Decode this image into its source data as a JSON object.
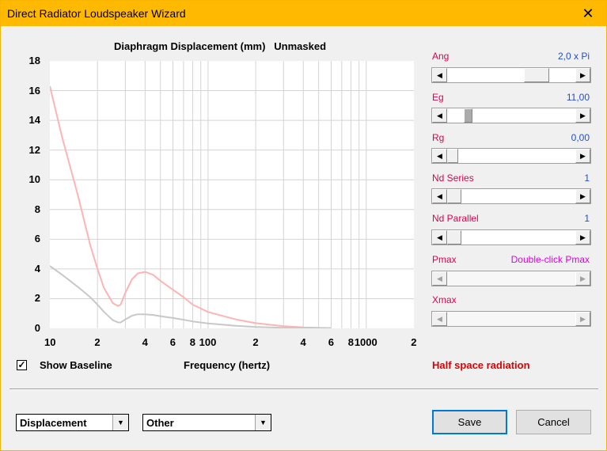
{
  "window": {
    "title": "Direct Radiator Loudspeaker Wizard",
    "close_glyph": "✕"
  },
  "chart_header": {
    "title": "Diaphragm Displacement (mm)",
    "mode": "Unmasked"
  },
  "chart_data": {
    "type": "line",
    "title": "Diaphragm Displacement (mm)   Unmasked",
    "xlabel": "Frequency (hertz)",
    "ylabel": "",
    "x_scale": "log",
    "xlim": [
      10,
      2000
    ],
    "ylim": [
      0,
      18
    ],
    "y_ticks": [
      "18",
      "16",
      "14",
      "12",
      "10",
      "8",
      "6",
      "4",
      "2",
      "0"
    ],
    "x_tick_labels": [
      "10",
      "2",
      "4",
      "6",
      "8",
      "100",
      "2",
      "4",
      "6",
      "8",
      "1000",
      "2"
    ],
    "grid": true,
    "series": [
      {
        "color": "#ffb3b3",
        "x": [
          10,
          12,
          15,
          18,
          20,
          22,
          25,
          27,
          28,
          30,
          33,
          36,
          40,
          45,
          50,
          60,
          70,
          80,
          100,
          150,
          200,
          300,
          400,
          500,
          600
        ],
        "y": [
          16.3,
          12.8,
          9.0,
          5.6,
          4.0,
          2.7,
          1.7,
          1.5,
          1.6,
          2.4,
          3.3,
          3.7,
          3.8,
          3.6,
          3.2,
          2.6,
          2.1,
          1.6,
          1.1,
          0.6,
          0.35,
          0.15,
          0.07,
          0.04,
          0.02
        ]
      },
      {
        "color": "#c8c8c8",
        "x": [
          10,
          12,
          15,
          18,
          20,
          22,
          25,
          27,
          28,
          30,
          33,
          36,
          40,
          45,
          50,
          60,
          70,
          80,
          100,
          150,
          200,
          300,
          400,
          500,
          600
        ],
        "y": [
          4.2,
          3.6,
          2.8,
          2.1,
          1.6,
          1.1,
          0.55,
          0.4,
          0.4,
          0.6,
          0.85,
          0.95,
          0.95,
          0.9,
          0.82,
          0.7,
          0.58,
          0.47,
          0.33,
          0.17,
          0.09,
          0.04,
          0.02,
          0.01,
          0.0
        ]
      }
    ]
  },
  "baseline": {
    "checked_glyph": "✓",
    "label": "Show Baseline"
  },
  "radiation_text": "Half space radiation",
  "params": [
    {
      "label": "Ang",
      "value": "2,0 x Pi",
      "position": 0.85
    },
    {
      "label": "Eg",
      "value": "11,00",
      "position": 0.05
    },
    {
      "label": "Rg",
      "value": "0,00",
      "position": 0.0
    },
    {
      "label": "Nd  Series",
      "value": "1",
      "position": 0.0
    },
    {
      "label": "Nd  Parallel",
      "value": "1",
      "position": 0.0
    },
    {
      "label": "Pmax",
      "value": "Double-click Pmax"
    },
    {
      "label": "Xmax",
      "value": ""
    }
  ],
  "selects": {
    "response": "Displacement",
    "preset": "Other"
  },
  "buttons": {
    "save": "Save",
    "cancel": "Cancel"
  },
  "icons": {
    "left": "◀",
    "right": "▶",
    "down": "▼"
  }
}
